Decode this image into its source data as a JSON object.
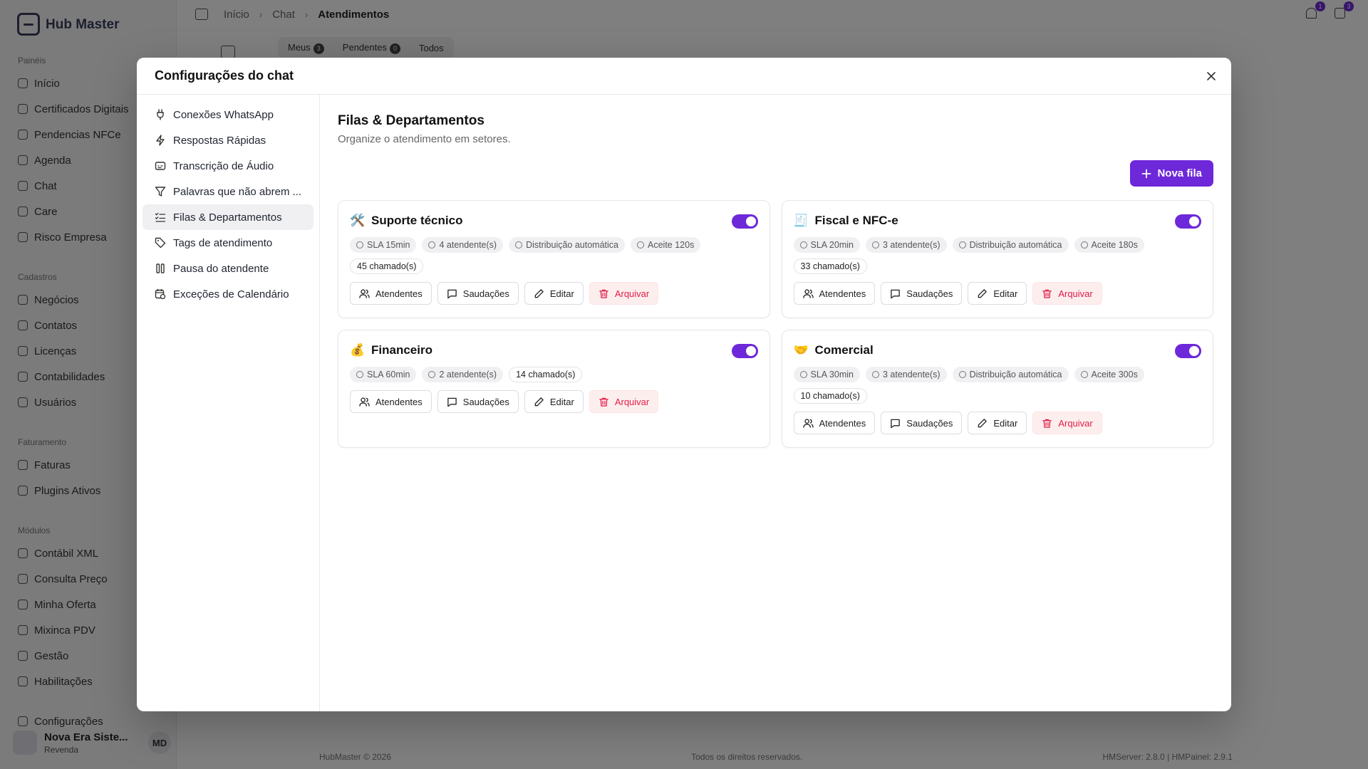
{
  "app": {
    "logo": "Hub Master",
    "sections": [
      "Painéis",
      "Cadastros",
      "Faturamento",
      "Módulos"
    ],
    "panel_items": [
      "Início",
      "Certificados Digitais",
      "Pendencias NFCe",
      "Agenda",
      "Chat",
      "Care",
      "Risco Empresa"
    ],
    "cadastro_items": [
      "Negócios",
      "Contatos",
      "Licenças",
      "Contabilidades",
      "Usuários"
    ],
    "fatur_items": [
      "Faturas",
      "Plugins Ativos"
    ],
    "modulo_items": [
      "Contábil XML",
      "Consulta Preço",
      "Minha Oferta",
      "Mixinca PDV",
      "Gestão",
      "Habilitações"
    ],
    "config_item": "Configurações",
    "workspace": {
      "name": "Nova Era Siste...",
      "sub": "Revenda",
      "initials": "MD"
    },
    "breadcrumb": [
      "Início",
      "Chat",
      "Atendimentos"
    ],
    "notif_count": "1",
    "msg_count": "3",
    "tabs": [
      {
        "label": "Meus",
        "count": "3"
      },
      {
        "label": "Pendentes",
        "count": "0"
      },
      {
        "label": "Todos",
        "count": ""
      }
    ],
    "footer": {
      "left": "HubMaster © 2026",
      "center": "Todos os direitos reservados.",
      "right": "HMServer: 2.8.0 | HMPainel: 2.9.1"
    }
  },
  "modal": {
    "title": "Configurações do chat",
    "nav": [
      {
        "label": "Conexões WhatsApp",
        "icon": "plug-icon"
      },
      {
        "label": "Respostas Rápidas",
        "icon": "zap-icon"
      },
      {
        "label": "Transcrição de Áudio",
        "icon": "captions-icon"
      },
      {
        "label": "Palavras que não abrem ...",
        "icon": "filter-icon"
      },
      {
        "label": "Filas & Departamentos",
        "icon": "list-checks-icon"
      },
      {
        "label": "Tags de atendimento",
        "icon": "tag-icon"
      },
      {
        "label": "Pausa do atendente",
        "icon": "pause-icon"
      },
      {
        "label": "Exceções de Calendário",
        "icon": "calendar-clock-icon"
      }
    ],
    "section_title": "Filas & Departamentos",
    "section_subtitle": "Organize o atendimento em setores.",
    "new_button": "Nova fila",
    "action_labels": {
      "agents": "Atendentes",
      "greetings": "Saudações",
      "edit": "Editar",
      "archive": "Arquivar"
    },
    "queues": [
      {
        "emoji": "🛠️",
        "name": "Suporte técnico",
        "enabled": true,
        "sla": "SLA 15min",
        "agents": "4 atendente(s)",
        "distribution": "Distribuição automática",
        "accept": "Aceite 120s",
        "tickets": "45 chamado(s)"
      },
      {
        "emoji": "🧾",
        "name": "Fiscal e NFC-e",
        "enabled": true,
        "sla": "SLA 20min",
        "agents": "3 atendente(s)",
        "distribution": "Distribuição automática",
        "accept": "Aceite 180s",
        "tickets": "33 chamado(s)"
      },
      {
        "emoji": "💰",
        "name": "Financeiro",
        "enabled": true,
        "sla": "SLA 60min",
        "agents": "2 atendente(s)",
        "distribution": "",
        "accept": "",
        "tickets": "14 chamado(s)"
      },
      {
        "emoji": "🤝",
        "name": "Comercial",
        "enabled": true,
        "sla": "SLA 30min",
        "agents": "3 atendente(s)",
        "distribution": "Distribuição automática",
        "accept": "Aceite 300s",
        "tickets": "10 chamado(s)"
      }
    ],
    "colors": {
      "accent": "#6d28d9",
      "danger": "#e11d48",
      "danger_bg": "#fdeeee"
    }
  }
}
